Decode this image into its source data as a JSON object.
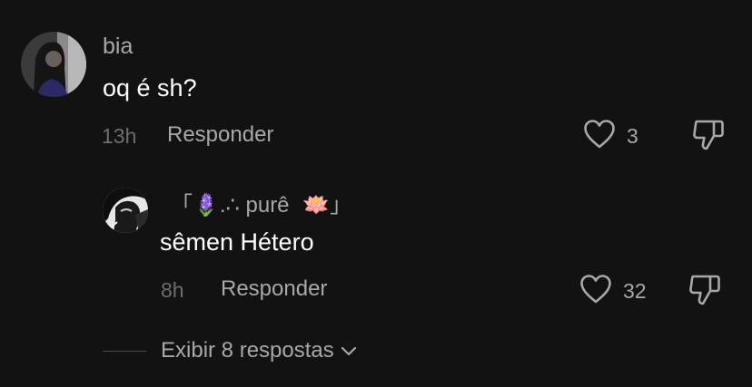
{
  "comment": {
    "username": "bia",
    "text": "oq é sh?",
    "time": "13h",
    "reply_label": "Responder",
    "like_count": "3"
  },
  "reply": {
    "username_prefix": "「",
    "username_emoji1": "🪻",
    "username_main": ".∴ purê ",
    "username_emoji2": "🪷",
    "username_suffix": "」",
    "text": "sêmen Hétero",
    "time": "8h",
    "reply_label": "Responder",
    "like_count": "32"
  },
  "view_replies_label": "Exibir 8 respostas",
  "icons": {
    "like": "heart-icon",
    "dislike": "thumbs-down-icon",
    "expand": "chevron-down-icon"
  },
  "colors": {
    "background": "#121212",
    "text_primary": "#ffffff",
    "text_secondary": "#a8a8a8",
    "text_muted": "#6e6e6e"
  }
}
